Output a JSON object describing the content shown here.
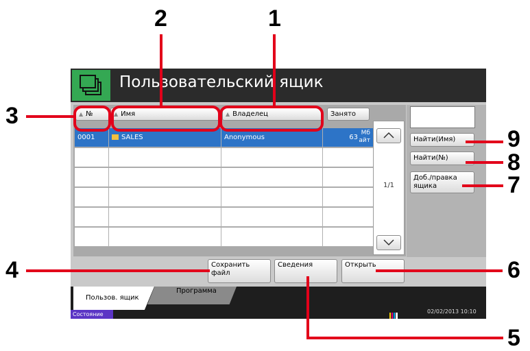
{
  "window": {
    "title": "Пользовательский ящик",
    "title_icon": "box-stack-icon"
  },
  "list": {
    "headers": {
      "number": "№",
      "name": "Имя",
      "owner": "Владелец",
      "used": "Занято"
    },
    "rows": [
      {
        "number": "0001",
        "name": "SALES",
        "owner": "Anonymous",
        "used_value": "63",
        "used_unit_1": "Мб",
        "used_unit_2": "айт",
        "icon": "folder-icon"
      }
    ],
    "page": "1/1"
  },
  "side_buttons": {
    "find_name": "Найти(Имя)",
    "find_number": "Найти(№)",
    "add_edit_line1": "Доб./правка",
    "add_edit_line2": "ящика"
  },
  "bottom_buttons": {
    "save_line1": "Сохранить",
    "save_line2": "файл",
    "details": "Сведения",
    "open": "Открыть"
  },
  "tabs": {
    "user_box": "Пользов. ящик",
    "program": "Программа"
  },
  "status": {
    "label": "Состояние",
    "datetime": "02/02/2013  10:10"
  },
  "callouts": [
    "1",
    "2",
    "3",
    "4",
    "5",
    "6",
    "7",
    "8",
    "9"
  ],
  "colors": {
    "accent_green": "#34a853",
    "callout_red": "#e2001a",
    "selection_blue": "#2d74c7",
    "status_purple": "#5b35c5"
  }
}
